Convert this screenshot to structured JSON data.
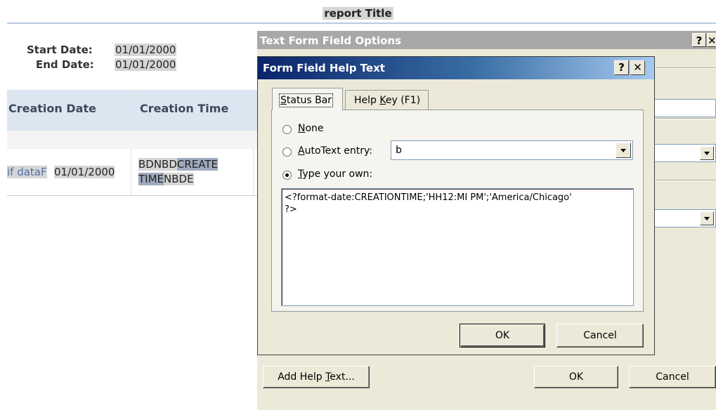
{
  "report": {
    "title": "report Title",
    "start_date_label": "Start Date:",
    "start_date_value": "01/01/2000",
    "end_date_label": "End Date:",
    "end_date_value": "01/01/2000",
    "table": {
      "headers": [
        "Creation Date",
        "Creation Time"
      ],
      "row_prefix": "if dataF",
      "row_date": "01/01/2000",
      "row_time_line1_a": "BDNBD",
      "row_time_line1_b": "CREATE",
      "row_time_line2_a": "TIME",
      "row_time_line2_b": "NBDE"
    }
  },
  "outer_dialog": {
    "title": "Text Form Field Options",
    "help_button": "?",
    "close_button": "✕",
    "add_help_text_pre": "Add Help ",
    "add_help_text_acc": "T",
    "add_help_text_post": "ext...",
    "ok_label": "OK",
    "cancel_label": "Cancel"
  },
  "help_dialog": {
    "title": "Form Field Help Text",
    "help_button": "?",
    "close_button": "✕",
    "tabs": {
      "status_bar_acc": "S",
      "status_bar_rest": "tatus Bar",
      "help_key_pre": "Help ",
      "help_key_acc": "K",
      "help_key_post": "ey (F1)"
    },
    "options": {
      "none_acc": "N",
      "none_rest": "one",
      "autotext_acc": "A",
      "autotext_rest": "utoText entry:",
      "type_own_acc": "T",
      "type_own_rest": "ype your own:",
      "selected": "type_your_own"
    },
    "autotext_value": "b",
    "text_value": "<?format-date:CREATIONTIME;'HH12:MI PM';'America/Chicago'\n?>",
    "ok_label": "OK",
    "cancel_label": "Cancel"
  },
  "colors": {
    "title_active_start": "#0a246a",
    "title_active_end": "#a6caf0",
    "title_inactive": "#a8a8a8",
    "dialog_face": "#ece9d8",
    "table_header_bg": "#dce6f1",
    "field_highlight": "#d6d6d6"
  }
}
